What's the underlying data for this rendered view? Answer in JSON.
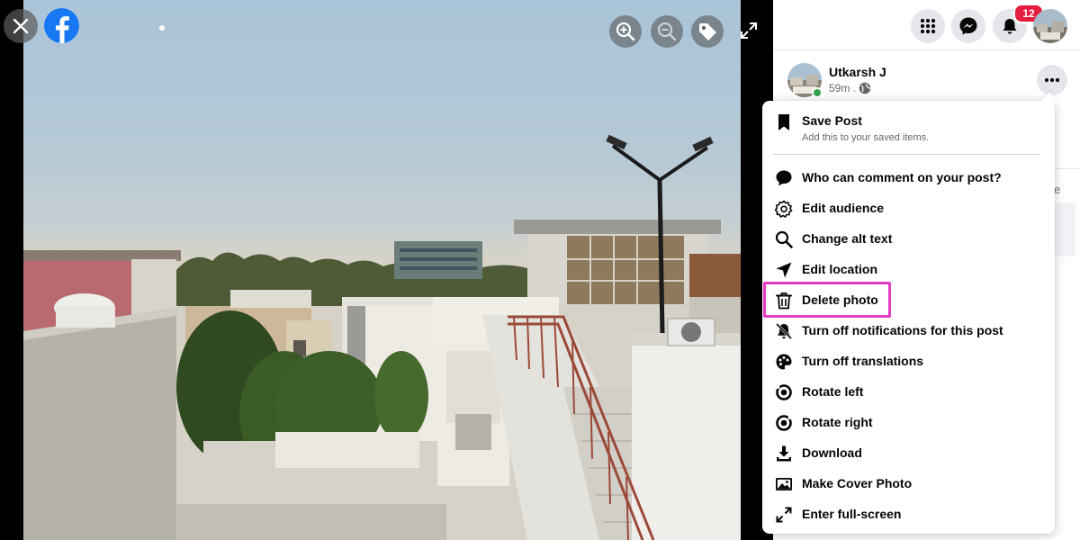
{
  "header": {
    "notification_count": "12"
  },
  "post": {
    "author": "Utkarsh J",
    "time": "59m ."
  },
  "side_text": "e",
  "menu": {
    "save_post": {
      "title": "Save Post",
      "subtitle": "Add this to your saved items.",
      "icon": "bookmark-icon"
    },
    "items": [
      {
        "label": "Who can comment on your post?",
        "icon": "comment-icon"
      },
      {
        "label": "Edit audience",
        "icon": "gear-icon"
      },
      {
        "label": "Change alt text",
        "icon": "search-icon"
      },
      {
        "label": "Edit location",
        "icon": "location-arrow-icon"
      },
      {
        "label": "Delete photo",
        "icon": "trash-icon",
        "highlighted": true
      },
      {
        "label": "Turn off notifications for this post",
        "icon": "bell-off-icon"
      },
      {
        "label": "Turn off translations",
        "icon": "palette-icon"
      },
      {
        "label": "Rotate left",
        "icon": "rotate-left-icon"
      },
      {
        "label": "Rotate right",
        "icon": "rotate-right-icon"
      },
      {
        "label": "Download",
        "icon": "download-icon"
      },
      {
        "label": "Make Cover Photo",
        "icon": "image-icon"
      },
      {
        "label": "Enter full-screen",
        "icon": "expand-icon"
      }
    ]
  },
  "colors": {
    "highlight": "#e43cc2",
    "facebook_blue": "#1877f2",
    "badge_red": "#e41e3f",
    "online_green": "#31a24c"
  }
}
